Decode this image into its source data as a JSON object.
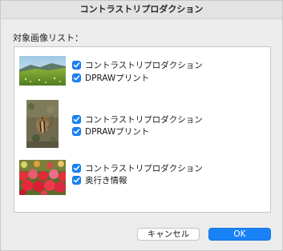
{
  "window": {
    "title": "コントラストリプロダクション"
  },
  "list": {
    "label": "対象画像リスト：",
    "items": [
      {
        "thumbnail": "landscape-thumbnail",
        "options": [
          {
            "label": "コントラストリプロダクション",
            "checked": true
          },
          {
            "label": "DPRAWプリント",
            "checked": true
          }
        ]
      },
      {
        "thumbnail": "chipmunk-thumbnail",
        "options": [
          {
            "label": "コントラストリプロダクション",
            "checked": true
          },
          {
            "label": "DPRAWプリント",
            "checked": true
          }
        ]
      },
      {
        "thumbnail": "flowers-thumbnail",
        "options": [
          {
            "label": "コントラストリプロダクション",
            "checked": true
          },
          {
            "label": "奥行き情報",
            "checked": true
          }
        ]
      }
    ]
  },
  "buttons": {
    "cancel": "キャンセル",
    "ok": "OK"
  },
  "colors": {
    "accent": "#1a82f7",
    "window_bg": "#ececec"
  }
}
